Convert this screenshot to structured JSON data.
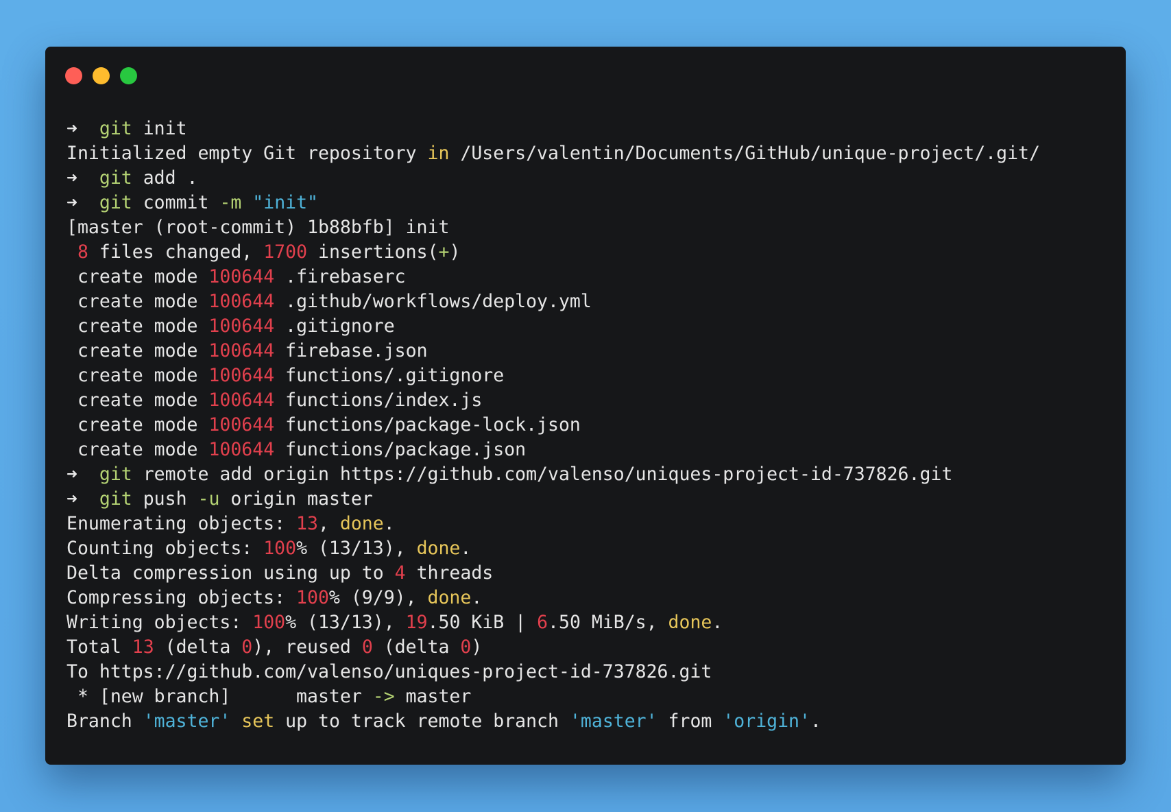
{
  "window": {
    "traffic_lights": [
      {
        "name": "close",
        "color": "#fe5f57"
      },
      {
        "name": "minimize",
        "color": "#febc2e"
      },
      {
        "name": "zoom",
        "color": "#28c840"
      }
    ]
  },
  "colors": {
    "background": "#5aa8e6",
    "terminal_bg": "#161719",
    "text": "#e6e6e6",
    "command": "#b4d273",
    "number": "#e2404d",
    "keyword": "#e7c65a",
    "string": "#4fb3d9"
  },
  "terminal": {
    "lines": [
      [
        {
          "t": "➜  "
        },
        {
          "t": "git",
          "c": "cmd"
        },
        {
          "t": " init"
        }
      ],
      [
        {
          "t": "Initialized empty Git repository "
        },
        {
          "t": "in",
          "c": "kw"
        },
        {
          "t": " /Users/valentin/Documents/GitHub/unique-project/.git/"
        }
      ],
      [
        {
          "t": "➜  "
        },
        {
          "t": "git",
          "c": "cmd"
        },
        {
          "t": " add ."
        }
      ],
      [
        {
          "t": "➜  "
        },
        {
          "t": "git",
          "c": "cmd"
        },
        {
          "t": " commit "
        },
        {
          "t": "-m",
          "c": "flag"
        },
        {
          "t": " "
        },
        {
          "t": "\"init\"",
          "c": "str"
        }
      ],
      [
        {
          "t": "[master (root-commit) 1b88bfb] init"
        }
      ],
      [
        {
          "t": " "
        },
        {
          "t": "8",
          "c": "num"
        },
        {
          "t": " files changed, "
        },
        {
          "t": "1700",
          "c": "num"
        },
        {
          "t": " insertions("
        },
        {
          "t": "+",
          "c": "plus"
        },
        {
          "t": ")"
        }
      ],
      [
        {
          "t": " create mode "
        },
        {
          "t": "100644",
          "c": "num"
        },
        {
          "t": " .firebaserc"
        }
      ],
      [
        {
          "t": " create mode "
        },
        {
          "t": "100644",
          "c": "num"
        },
        {
          "t": " .github/workflows/deploy.yml"
        }
      ],
      [
        {
          "t": " create mode "
        },
        {
          "t": "100644",
          "c": "num"
        },
        {
          "t": " .gitignore"
        }
      ],
      [
        {
          "t": " create mode "
        },
        {
          "t": "100644",
          "c": "num"
        },
        {
          "t": " firebase.json"
        }
      ],
      [
        {
          "t": " create mode "
        },
        {
          "t": "100644",
          "c": "num"
        },
        {
          "t": " functions/.gitignore"
        }
      ],
      [
        {
          "t": " create mode "
        },
        {
          "t": "100644",
          "c": "num"
        },
        {
          "t": " functions/index.js"
        }
      ],
      [
        {
          "t": " create mode "
        },
        {
          "t": "100644",
          "c": "num"
        },
        {
          "t": " functions/package-lock.json"
        }
      ],
      [
        {
          "t": " create mode "
        },
        {
          "t": "100644",
          "c": "num"
        },
        {
          "t": " functions/package.json"
        }
      ],
      [
        {
          "t": "➜  "
        },
        {
          "t": "git",
          "c": "cmd"
        },
        {
          "t": " remote add origin https://github.com/valenso/uniques-project-id-737826.git"
        }
      ],
      [
        {
          "t": "➜  "
        },
        {
          "t": "git",
          "c": "cmd"
        },
        {
          "t": " push "
        },
        {
          "t": "-u",
          "c": "flag"
        },
        {
          "t": " origin master"
        }
      ],
      [
        {
          "t": "Enumerating objects: "
        },
        {
          "t": "13",
          "c": "num"
        },
        {
          "t": ", "
        },
        {
          "t": "done",
          "c": "kw"
        },
        {
          "t": "."
        }
      ],
      [
        {
          "t": "Counting objects: "
        },
        {
          "t": "100",
          "c": "num"
        },
        {
          "t": "% (13/13), "
        },
        {
          "t": "done",
          "c": "kw"
        },
        {
          "t": "."
        }
      ],
      [
        {
          "t": "Delta compression using up to "
        },
        {
          "t": "4",
          "c": "num"
        },
        {
          "t": " threads"
        }
      ],
      [
        {
          "t": "Compressing objects: "
        },
        {
          "t": "100",
          "c": "num"
        },
        {
          "t": "% (9/9), "
        },
        {
          "t": "done",
          "c": "kw"
        },
        {
          "t": "."
        }
      ],
      [
        {
          "t": "Writing objects: "
        },
        {
          "t": "100",
          "c": "num"
        },
        {
          "t": "% (13/13), "
        },
        {
          "t": "19",
          "c": "num"
        },
        {
          "t": ".50 KiB | "
        },
        {
          "t": "6",
          "c": "num"
        },
        {
          "t": ".50 MiB/s, "
        },
        {
          "t": "done",
          "c": "kw"
        },
        {
          "t": "."
        }
      ],
      [
        {
          "t": "Total "
        },
        {
          "t": "13",
          "c": "num"
        },
        {
          "t": " (delta "
        },
        {
          "t": "0",
          "c": "num"
        },
        {
          "t": "), reused "
        },
        {
          "t": "0",
          "c": "num"
        },
        {
          "t": " (delta "
        },
        {
          "t": "0",
          "c": "num"
        },
        {
          "t": ")"
        }
      ],
      [
        {
          "t": "To https://github.com/valenso/uniques-project-id-737826.git"
        }
      ],
      [
        {
          "t": " * [new branch]      master "
        },
        {
          "t": "->",
          "c": "flag"
        },
        {
          "t": " master"
        }
      ],
      [
        {
          "t": "Branch "
        },
        {
          "t": "'master'",
          "c": "str"
        },
        {
          "t": " "
        },
        {
          "t": "set",
          "c": "kw"
        },
        {
          "t": " up to track remote branch "
        },
        {
          "t": "'master'",
          "c": "str"
        },
        {
          "t": " from "
        },
        {
          "t": "'origin'",
          "c": "str"
        },
        {
          "t": "."
        }
      ]
    ]
  }
}
